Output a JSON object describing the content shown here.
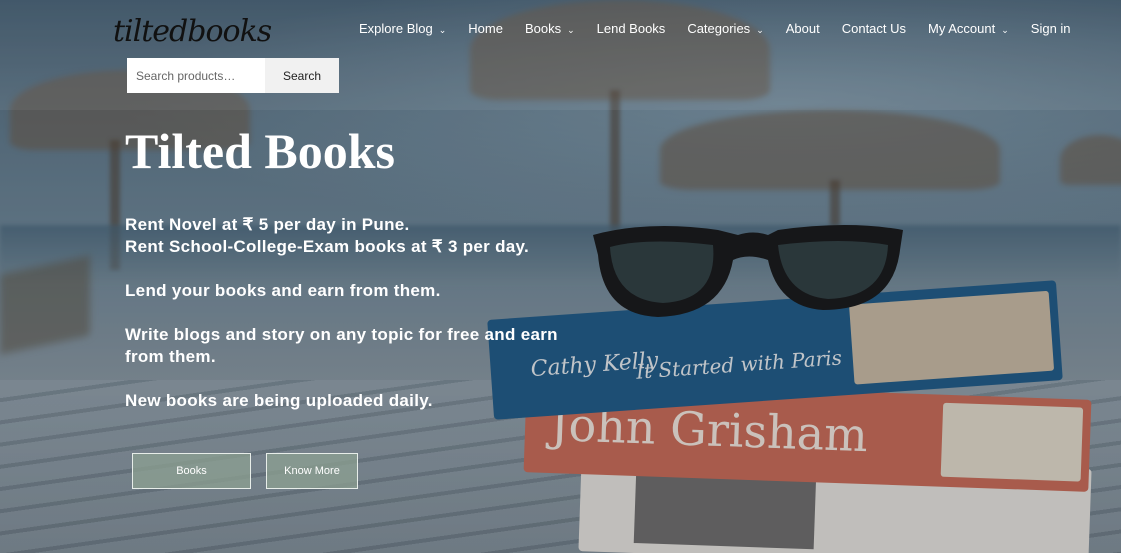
{
  "brand": {
    "logo": "tiltedbooks"
  },
  "nav": {
    "items": [
      {
        "label": "Explore Blog",
        "has_dropdown": true
      },
      {
        "label": "Home",
        "has_dropdown": false
      },
      {
        "label": "Books",
        "has_dropdown": true
      },
      {
        "label": "Lend Books",
        "has_dropdown": false
      },
      {
        "label": "Categories",
        "has_dropdown": true
      },
      {
        "label": "About",
        "has_dropdown": false
      },
      {
        "label": "Contact Us",
        "has_dropdown": false
      },
      {
        "label": "My Account",
        "has_dropdown": true
      },
      {
        "label": "Sign in",
        "has_dropdown": false
      }
    ],
    "chevron": "⌄"
  },
  "search": {
    "placeholder": "Search products…",
    "value": "",
    "button_label": "Search"
  },
  "hero": {
    "title": "Tilted Books",
    "line1": "Rent Novel at ₹ 5 per day in Pune.",
    "line2": "Rent School-College-Exam books at ₹ 3 per day.",
    "line3": "Lend your books and earn from them.",
    "line4": "Write blogs and story on any topic for free and earn from them.",
    "line5": "New books are being uploaded daily.",
    "buttons": {
      "books": "Books",
      "know_more": "Know More"
    }
  },
  "background": {
    "book_top_author": "Cathy Kelly",
    "book_top_title": "It Started with Paris",
    "book_middle_author": "John Grisham"
  },
  "colors": {
    "nav_text": "#ffffff",
    "button_bg": "#8ca091",
    "search_bg": "#f1f1f1"
  }
}
